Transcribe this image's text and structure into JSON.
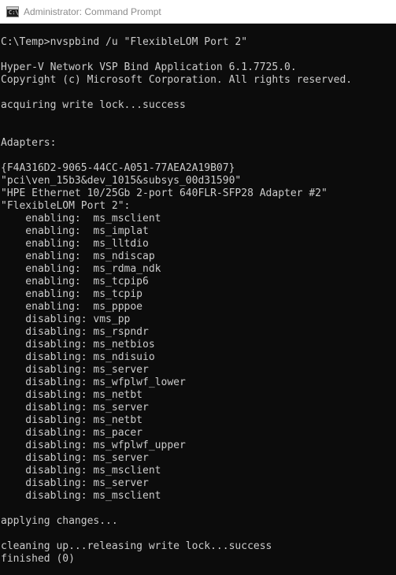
{
  "window": {
    "title": "Administrator: Command Prompt",
    "icon": "cmd-icon"
  },
  "console": {
    "lines": [
      "C:\\Temp>nvspbind /u \"FlexibleLOM Port 2\"",
      "",
      "Hyper-V Network VSP Bind Application 6.1.7725.0.",
      "Copyright (c) Microsoft Corporation. All rights reserved.",
      "",
      "acquiring write lock...success",
      "",
      "",
      "Adapters:",
      "",
      "{F4A316D2-9065-44CC-A051-77AEA2A19B07}",
      "\"pci\\ven_15b3&dev_1015&subsys_00d31590\"",
      "\"HPE Ethernet 10/25Gb 2-port 640FLR-SFP28 Adapter #2\"",
      "\"FlexibleLOM Port 2\":",
      "    enabling:  ms_msclient",
      "    enabling:  ms_implat",
      "    enabling:  ms_lltdio",
      "    enabling:  ms_ndiscap",
      "    enabling:  ms_rdma_ndk",
      "    enabling:  ms_tcpip6",
      "    enabling:  ms_tcpip",
      "    enabling:  ms_pppoe",
      "    disabling: vms_pp",
      "    disabling: ms_rspndr",
      "    disabling: ms_netbios",
      "    disabling: ms_ndisuio",
      "    disabling: ms_server",
      "    disabling: ms_wfplwf_lower",
      "    disabling: ms_netbt",
      "    disabling: ms_server",
      "    disabling: ms_netbt",
      "    disabling: ms_pacer",
      "    disabling: ms_wfplwf_upper",
      "    disabling: ms_server",
      "    disabling: ms_msclient",
      "    disabling: ms_server",
      "    disabling: ms_msclient",
      "",
      "applying changes...",
      "",
      "cleaning up...releasing write lock...success",
      "finished (0)"
    ]
  },
  "colors": {
    "console_bg": "#0c0c0c",
    "console_fg": "#cccccc",
    "titlebar_bg": "#ffffff",
    "title_fg": "#8c8c8c"
  }
}
